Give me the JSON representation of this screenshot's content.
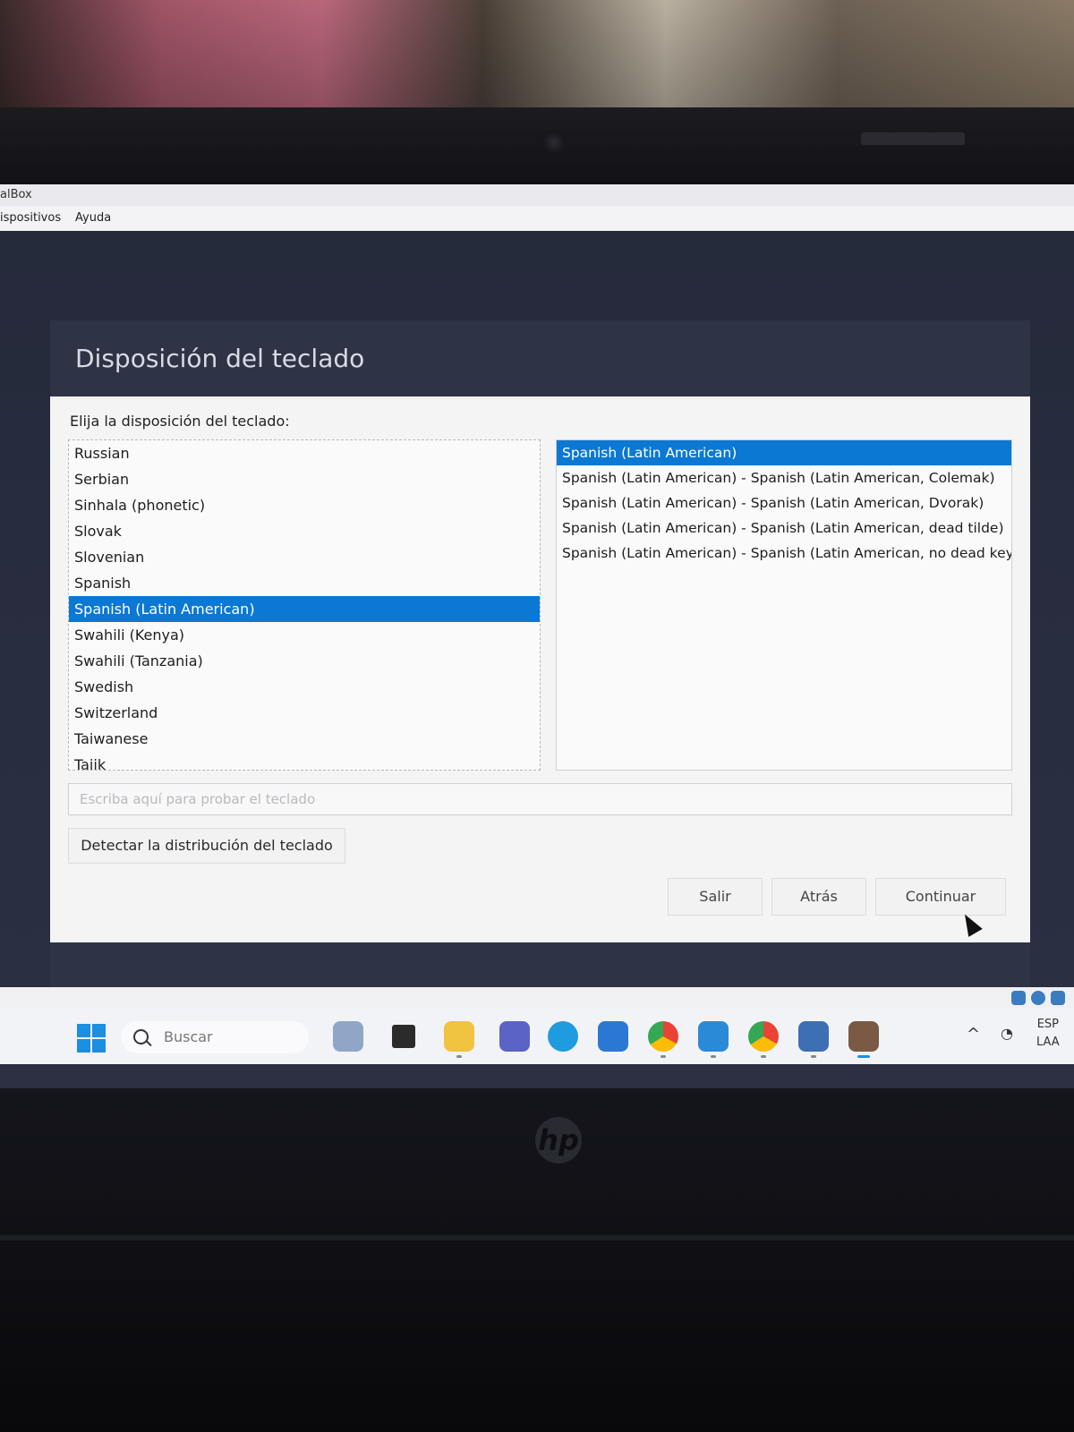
{
  "virtualbox": {
    "title": "alBox",
    "menu": [
      "ispositivos",
      "Ayuda"
    ]
  },
  "installer": {
    "title": "Disposición del teclado",
    "prompt": "Elija la disposición del teclado:",
    "layouts": [
      {
        "label": "Russian",
        "selected": false
      },
      {
        "label": "Serbian",
        "selected": false
      },
      {
        "label": "Sinhala (phonetic)",
        "selected": false
      },
      {
        "label": "Slovak",
        "selected": false
      },
      {
        "label": "Slovenian",
        "selected": false
      },
      {
        "label": "Spanish",
        "selected": false
      },
      {
        "label": "Spanish (Latin American)",
        "selected": true
      },
      {
        "label": "Swahili (Kenya)",
        "selected": false
      },
      {
        "label": "Swahili (Tanzania)",
        "selected": false
      },
      {
        "label": "Swedish",
        "selected": false
      },
      {
        "label": "Switzerland",
        "selected": false
      },
      {
        "label": "Taiwanese",
        "selected": false
      },
      {
        "label": "Tajik",
        "selected": false
      }
    ],
    "variants": [
      {
        "label": "Spanish (Latin American)",
        "selected": true
      },
      {
        "label": "Spanish (Latin American) - Spanish (Latin American, Colemak)",
        "selected": false
      },
      {
        "label": "Spanish (Latin American) - Spanish (Latin American, Dvorak)",
        "selected": false
      },
      {
        "label": "Spanish (Latin American) - Spanish (Latin American, dead tilde)",
        "selected": false
      },
      {
        "label": "Spanish (Latin American) - Spanish (Latin American, no dead keys)",
        "selected": false
      }
    ],
    "test_input": {
      "placeholder": "Escriba aquí para probar el teclado",
      "value": ""
    },
    "detect_button": "Detectar la distribución del teclado",
    "buttons": {
      "quit": "Salir",
      "back": "Atrás",
      "continue": "Continuar"
    }
  },
  "taskbar": {
    "search_placeholder": "Buscar",
    "apps": [
      "virtualbox-icon",
      "terminal-icon",
      "file-explorer-icon",
      "teams-icon",
      "edge-icon",
      "store-icon",
      "chrome-icon",
      "vscode-icon",
      "chrome-icon",
      "virtualbox-manager-icon",
      "app-icon"
    ],
    "language_line1": "ESP",
    "language_line2": "LAA"
  },
  "colors": {
    "selection": "#0b78d4",
    "windows_accent": "#1c8fe0"
  },
  "laptop_brand": "hp"
}
